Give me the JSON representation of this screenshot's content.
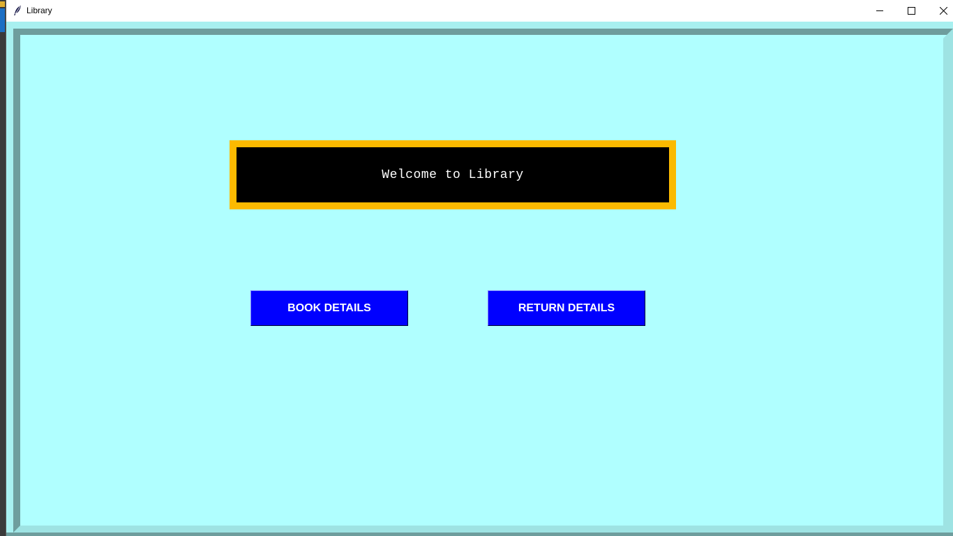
{
  "window": {
    "title": "Library",
    "controls": {
      "minimize": "minimize-icon",
      "maximize": "maximize-icon",
      "close": "close-icon"
    }
  },
  "main": {
    "welcome_text": "Welcome to Library",
    "buttons": {
      "book_details": "BOOK DETAILS",
      "return_details": "RETURN DETAILS"
    }
  },
  "colors": {
    "background": "#b0ffff",
    "welcome_border": "#fbba00",
    "welcome_fill": "#000000",
    "button_fill": "#0000ff",
    "button_text": "#ffffff"
  }
}
